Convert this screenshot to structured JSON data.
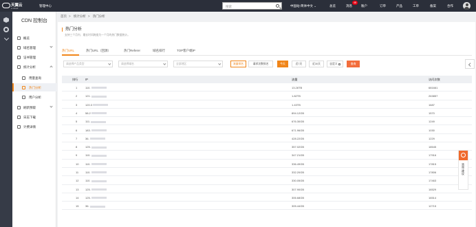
{
  "topbar": {
    "brand": "天翼云",
    "brand_sub": "e Cloud",
    "mgmt_center": "管理中心",
    "search_placeholder": "搜索",
    "region": "中国站-简体中文",
    "nav": {
      "menu_1": "总览",
      "message": "消息",
      "message_count": "48",
      "account": "账户",
      "orders": "订单",
      "products": "产品",
      "tickets": "工单",
      "filing": "备案",
      "partner": "合作"
    }
  },
  "sidebar": {
    "title": "CDN 控制台",
    "items": [
      {
        "label": "概览"
      },
      {
        "label": "域名管理"
      },
      {
        "label": "证书管理"
      },
      {
        "label": "统计分析"
      },
      {
        "label": "用量查询"
      },
      {
        "label": "热门分析"
      },
      {
        "label": "用户分析"
      },
      {
        "label": "刷新预取"
      },
      {
        "label": "日志下载"
      },
      {
        "label": "计费详情"
      }
    ]
  },
  "breadcrumb": [
    "首页",
    "统计分析",
    "热门分析"
  ],
  "page": {
    "title": "热门分析",
    "description": "支持三个月内、最长时间跨度为一个月的热门数据统计。"
  },
  "tabs": [
    "热门URL",
    "热门URL（回源）",
    "热门Referer",
    "域名排行",
    "TOP客户端IP"
  ],
  "filters": {
    "product_placeholder": "请选择产品类型",
    "domain_placeholder": "请选择域名",
    "region_value": "全部地区",
    "btn_traffic_rank": "流量排名",
    "btn_request_rank": "请求次数排名",
    "btn_today": "今天",
    "btn_7days": "近7天",
    "btn_30days": "近30天",
    "btn_custom": "自定义",
    "btn_query": "查询"
  },
  "table": {
    "headers": [
      "排行",
      "IP",
      "流量",
      "访问次数"
    ],
    "rows": [
      {
        "rank": "1",
        "ip": "110.",
        "traffic": "13.28TB",
        "visits": "681661"
      },
      {
        "rank": "2",
        "ip": "121.",
        "traffic": "1.82TB",
        "visits": "263857"
      },
      {
        "rank": "3",
        "ip": "120.3",
        "traffic": "1.43TB",
        "visits": "1687"
      },
      {
        "rank": "4",
        "ip": "58.2",
        "traffic": "894.12GB",
        "visits": "1570"
      },
      {
        "rank": "5",
        "ip": "111.",
        "traffic": "676.30GB",
        "visits": "1249"
      },
      {
        "rank": "6",
        "ip": "183.",
        "traffic": "671.96GB",
        "visits": "1030"
      },
      {
        "rank": "7",
        "ip": "36.",
        "traffic": "428.22GB",
        "visits": "1229"
      },
      {
        "rank": "8",
        "ip": "125.",
        "traffic": "357.02GB",
        "visits": "18545"
      },
      {
        "rank": "9",
        "ip": "110.",
        "traffic": "347.21GB",
        "visits": "17916"
      },
      {
        "rank": "10",
        "ip": "110.",
        "traffic": "336.49GB",
        "visits": "17815"
      },
      {
        "rank": "11",
        "ip": "110.",
        "traffic": "332.20GB",
        "visits": "17806"
      },
      {
        "rank": "12",
        "ip": "110.",
        "traffic": "330.05GB",
        "visits": "17463"
      },
      {
        "rank": "13",
        "ip": "125.",
        "traffic": "307.90GB",
        "visits": "16529"
      },
      {
        "rank": "14",
        "ip": "125.",
        "traffic": "306.68GB",
        "visits": "16514"
      },
      {
        "rank": "15",
        "ip": "36.",
        "traffic": "305.44GB",
        "visits": "12715"
      }
    ]
  },
  "feedback": {
    "label": "咨询·建议"
  },
  "colors": {
    "accent": "#f08519",
    "topbar": "#2b2f3a",
    "query_button": "#f26d3c"
  }
}
